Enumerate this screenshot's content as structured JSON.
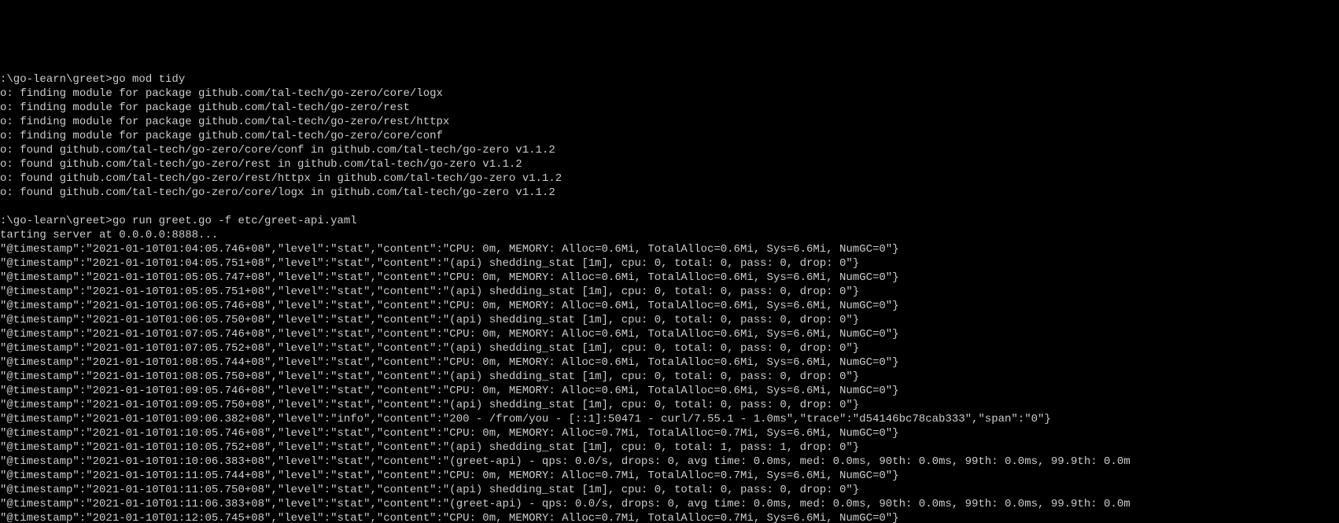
{
  "lines": [
    ":\\go-learn\\greet>go mod tidy",
    "o: finding module for package github.com/tal-tech/go-zero/core/logx",
    "o: finding module for package github.com/tal-tech/go-zero/rest",
    "o: finding module for package github.com/tal-tech/go-zero/rest/httpx",
    "o: finding module for package github.com/tal-tech/go-zero/core/conf",
    "o: found github.com/tal-tech/go-zero/core/conf in github.com/tal-tech/go-zero v1.1.2",
    "o: found github.com/tal-tech/go-zero/rest in github.com/tal-tech/go-zero v1.1.2",
    "o: found github.com/tal-tech/go-zero/rest/httpx in github.com/tal-tech/go-zero v1.1.2",
    "o: found github.com/tal-tech/go-zero/core/logx in github.com/tal-tech/go-zero v1.1.2",
    "",
    ":\\go-learn\\greet>go run greet.go -f etc/greet-api.yaml",
    "tarting server at 0.0.0.0:8888...",
    "\"@timestamp\":\"2021-01-10T01:04:05.746+08\",\"level\":\"stat\",\"content\":\"CPU: 0m, MEMORY: Alloc=0.6Mi, TotalAlloc=0.6Mi, Sys=6.6Mi, NumGC=0\"}",
    "\"@timestamp\":\"2021-01-10T01:04:05.751+08\",\"level\":\"stat\",\"content\":\"(api) shedding_stat [1m], cpu: 0, total: 0, pass: 0, drop: 0\"}",
    "\"@timestamp\":\"2021-01-10T01:05:05.747+08\",\"level\":\"stat\",\"content\":\"CPU: 0m, MEMORY: Alloc=0.6Mi, TotalAlloc=0.6Mi, Sys=6.6Mi, NumGC=0\"}",
    "\"@timestamp\":\"2021-01-10T01:05:05.751+08\",\"level\":\"stat\",\"content\":\"(api) shedding_stat [1m], cpu: 0, total: 0, pass: 0, drop: 0\"}",
    "\"@timestamp\":\"2021-01-10T01:06:05.746+08\",\"level\":\"stat\",\"content\":\"CPU: 0m, MEMORY: Alloc=0.6Mi, TotalAlloc=0.6Mi, Sys=6.6Mi, NumGC=0\"}",
    "\"@timestamp\":\"2021-01-10T01:06:05.750+08\",\"level\":\"stat\",\"content\":\"(api) shedding_stat [1m], cpu: 0, total: 0, pass: 0, drop: 0\"}",
    "\"@timestamp\":\"2021-01-10T01:07:05.746+08\",\"level\":\"stat\",\"content\":\"CPU: 0m, MEMORY: Alloc=0.6Mi, TotalAlloc=0.6Mi, Sys=6.6Mi, NumGC=0\"}",
    "\"@timestamp\":\"2021-01-10T01:07:05.752+08\",\"level\":\"stat\",\"content\":\"(api) shedding_stat [1m], cpu: 0, total: 0, pass: 0, drop: 0\"}",
    "\"@timestamp\":\"2021-01-10T01:08:05.744+08\",\"level\":\"stat\",\"content\":\"CPU: 0m, MEMORY: Alloc=0.6Mi, TotalAlloc=0.6Mi, Sys=6.6Mi, NumGC=0\"}",
    "\"@timestamp\":\"2021-01-10T01:08:05.750+08\",\"level\":\"stat\",\"content\":\"(api) shedding_stat [1m], cpu: 0, total: 0, pass: 0, drop: 0\"}",
    "\"@timestamp\":\"2021-01-10T01:09:05.746+08\",\"level\":\"stat\",\"content\":\"CPU: 0m, MEMORY: Alloc=0.6Mi, TotalAlloc=0.6Mi, Sys=6.6Mi, NumGC=0\"}",
    "\"@timestamp\":\"2021-01-10T01:09:05.750+08\",\"level\":\"stat\",\"content\":\"(api) shedding_stat [1m], cpu: 0, total: 0, pass: 0, drop: 0\"}",
    "\"@timestamp\":\"2021-01-10T01:09:06.382+08\",\"level\":\"info\",\"content\":\"200 - /from/you - [::1]:50471 - curl/7.55.1 - 1.0ms\",\"trace\":\"d54146bc78cab333\",\"span\":\"0\"}",
    "\"@timestamp\":\"2021-01-10T01:10:05.746+08\",\"level\":\"stat\",\"content\":\"CPU: 0m, MEMORY: Alloc=0.7Mi, TotalAlloc=0.7Mi, Sys=6.6Mi, NumGC=0\"}",
    "\"@timestamp\":\"2021-01-10T01:10:05.752+08\",\"level\":\"stat\",\"content\":\"(api) shedding_stat [1m], cpu: 0, total: 1, pass: 1, drop: 0\"}",
    "\"@timestamp\":\"2021-01-10T01:10:06.383+08\",\"level\":\"stat\",\"content\":\"(greet-api) - qps: 0.0/s, drops: 0, avg time: 0.0ms, med: 0.0ms, 90th: 0.0ms, 99th: 0.0ms, 99.9th: 0.0m",
    "\"@timestamp\":\"2021-01-10T01:11:05.744+08\",\"level\":\"stat\",\"content\":\"CPU: 0m, MEMORY: Alloc=0.7Mi, TotalAlloc=0.7Mi, Sys=6.6Mi, NumGC=0\"}",
    "\"@timestamp\":\"2021-01-10T01:11:05.750+08\",\"level\":\"stat\",\"content\":\"(api) shedding_stat [1m], cpu: 0, total: 0, pass: 0, drop: 0\"}",
    "\"@timestamp\":\"2021-01-10T01:11:06.383+08\",\"level\":\"stat\",\"content\":\"(greet-api) - qps: 0.0/s, drops: 0, avg time: 0.0ms, med: 0.0ms, 90th: 0.0ms, 99th: 0.0ms, 99.9th: 0.0m",
    "\"@timestamp\":\"2021-01-10T01:12:05.745+08\",\"level\":\"stat\",\"content\":\"CPU: 0m, MEMORY: Alloc=0.7Mi, TotalAlloc=0.7Mi, Sys=6.6Mi, NumGC=0\"}"
  ]
}
